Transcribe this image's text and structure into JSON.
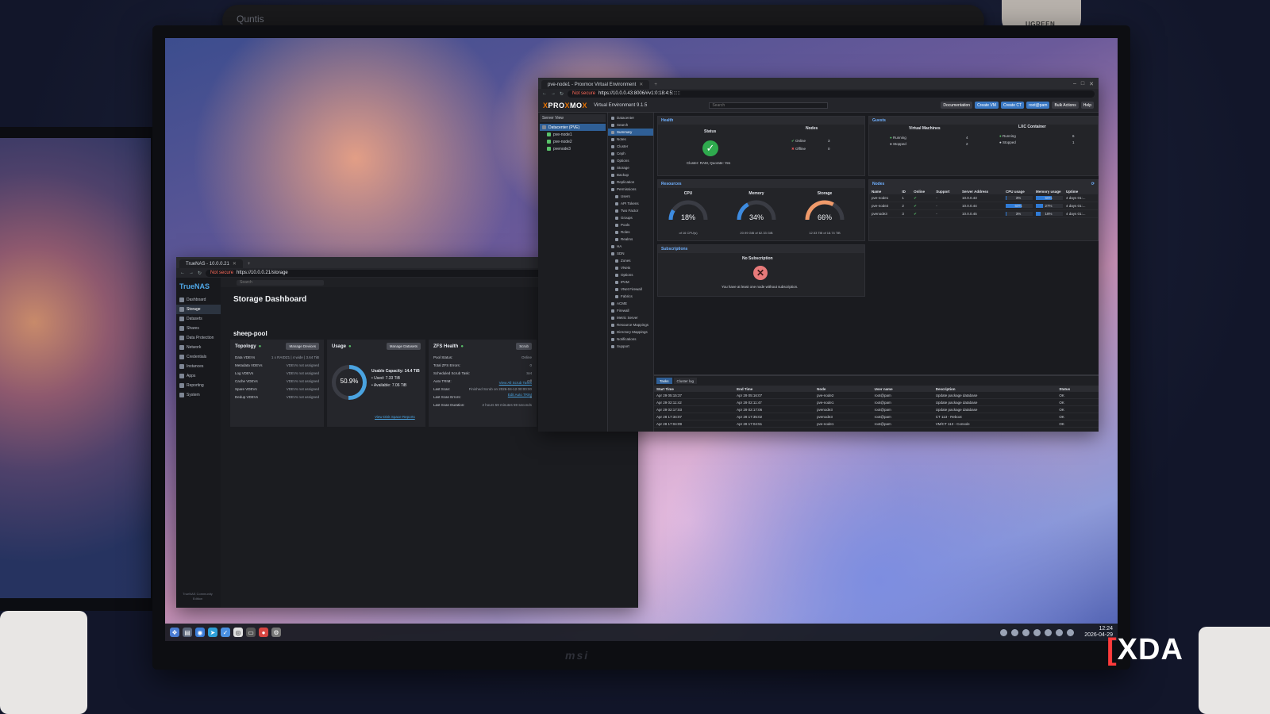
{
  "room": {
    "lightbar_brand": "Quntis",
    "webcam_brand": "UGREEN",
    "monitor_brand": "msi"
  },
  "watermark": {
    "bracket": "[",
    "text": "XDA"
  },
  "taskbar": {
    "clock_time": "12:24",
    "clock_date": "2026-04-29"
  },
  "truenas": {
    "tab_title": "TrueNAS - 10.0.0.21",
    "url_not_secure": "Not secure",
    "url": "https://10.0.0.21/storage",
    "logo": "TrueNAS",
    "search_placeholder": "Search",
    "page_title": "Storage Dashboard",
    "pool_name": "sheep-pool",
    "nav": [
      "Dashboard",
      "Storage",
      "Datasets",
      "Shares",
      "Data Protection",
      "Network",
      "Credentials",
      "Instances",
      "Apps",
      "Reporting",
      "System"
    ],
    "topology": {
      "title": "Topology",
      "button": "Manage Devices",
      "rows": [
        {
          "k": "Data VDEVs",
          "v": "1 x RAIDZ1 | 4 wide | 3.64 TiB"
        },
        {
          "k": "Metadata VDEVs",
          "v": "VDEVs not assigned"
        },
        {
          "k": "Log VDEVs",
          "v": "VDEVs not assigned"
        },
        {
          "k": "Cache VDEVs",
          "v": "VDEVs not assigned"
        },
        {
          "k": "Spare VDEVs",
          "v": "VDEVs not assigned"
        },
        {
          "k": "Dedup VDEVs",
          "v": "VDEVs not assigned"
        }
      ]
    },
    "usage": {
      "title": "Usage",
      "button": "Manage Datasets",
      "percent": 50.9,
      "percent_label": "50.9%",
      "capacity": "Usable Capacity: 14.4 TiB",
      "used": "Used: 7.33 TiB",
      "available": "Available: 7.06 TiB",
      "link": "View Disk Space Reports"
    },
    "zfs": {
      "title": "ZFS Health",
      "button": "Scrub",
      "rows": [
        {
          "k": "Pool Status:",
          "v": "Online"
        },
        {
          "k": "Total ZFS Errors:",
          "v": "0"
        },
        {
          "k": "Scheduled Scrub Task:",
          "v": "Set"
        },
        {
          "k": "Auto TRIM:",
          "v": "Off"
        },
        {
          "k": "Last Scan:",
          "v": "Finished Scrub on 2026-04-12 00:00:00"
        },
        {
          "k": "Last Scan Errors:",
          "v": "0"
        },
        {
          "k": "Last Scan Duration:",
          "v": "2 hours 59 minutes 59 seconds"
        }
      ],
      "link1": "View All Scrub Tasks",
      "link2": "Edit Auto TRIM"
    },
    "footer": "TrueNAS Community Edition"
  },
  "proxmox": {
    "tab_title": "pve-node1 - Proxmox Virtual Environment",
    "url_not_secure": "Not secure",
    "url": "https://10.0.0.43:8006/#v1:0:18:4:5::::::",
    "logo_pro": "PRO",
    "logo_x": "X",
    "logo_mo": "MO",
    "version": "Virtual Environment 9.1.5",
    "search_placeholder": "Search",
    "header_buttons": [
      "Documentation",
      "Create VM",
      "Create CT",
      "root@pam"
    ],
    "bulk_actions": "Bulk Actions",
    "help": "Help",
    "tree": {
      "view": "Server View",
      "items": [
        "Datacenter (PVE)",
        "pve-node1",
        "pve-node2",
        "pvenode3"
      ]
    },
    "menu": [
      "Datacenter",
      "Search",
      "Summary",
      "Notes",
      "Cluster",
      "Ceph",
      "Options",
      "Storage",
      "Backup",
      "Replication",
      "Permissions",
      "Users",
      "API Tokens",
      "Two Factor",
      "Groups",
      "Pools",
      "Roles",
      "Realms",
      "HA",
      "SDN",
      "Zones",
      "VNets",
      "Options",
      "IPAM",
      "VNet Firewall",
      "Fabrics",
      "ACME",
      "Firewall",
      "Metric Server",
      "Resource Mappings",
      "Directory Mappings",
      "Notifications",
      "Support"
    ],
    "health": {
      "title": "Health",
      "status_label": "Status",
      "nodes_label": "Nodes",
      "cluster_text": "Cluster: RAM, Quorate: Yes",
      "online_label": "Online",
      "online_count": 3,
      "offline_label": "Offline",
      "offline_count": 0
    },
    "guests": {
      "title": "Guests",
      "vm_label": "Virtual Machines",
      "ct_label": "LXC Container",
      "vm_running_label": "Running",
      "vm_running": 4,
      "vm_stopped_label": "Stopped",
      "vm_stopped": 2,
      "ct_running_label": "Running",
      "ct_running": 6,
      "ct_stopped_label": "Stopped",
      "ct_stopped": 1
    },
    "resources": {
      "title": "Resources",
      "cpu": {
        "label": "CPU",
        "value": 18,
        "text": "18%",
        "sub": "of 16 CPU(s)"
      },
      "memory": {
        "label": "Memory",
        "value": 34,
        "text": "34%",
        "sub": "20.99 GiB of 62.33 GiB"
      },
      "storage": {
        "label": "Storage",
        "value": 66,
        "text": "66%",
        "sub": "12.53 TiB of 18.74 TiB"
      }
    },
    "subscriptions": {
      "title": "Subscriptions",
      "heading": "No Subscription",
      "text": "You have at least one node without subscription."
    },
    "nodes": {
      "title": "Nodes",
      "columns": [
        "Name",
        "ID",
        "Online",
        "Support",
        "Server Address",
        "CPU usage",
        "Memory usage",
        "Uptime"
      ],
      "rows": [
        {
          "name": "pve-node1",
          "id": "1",
          "online": "✔",
          "support": "-",
          "addr": "10.0.0.43",
          "cpu": 3,
          "cpu_text": "3%",
          "mem": 60,
          "mem_text": "60%",
          "uptime": "4 days 01:..."
        },
        {
          "name": "pve-node2",
          "id": "2",
          "online": "✔",
          "support": "-",
          "addr": "10.0.0.44",
          "cpu": 60,
          "cpu_text": "60%",
          "mem": 27,
          "mem_text": "27%",
          "uptime": "4 days 01:..."
        },
        {
          "name": "pvenode3",
          "id": "3",
          "online": "✔",
          "support": "-",
          "addr": "10.0.0.45",
          "cpu": 3,
          "cpu_text": "3%",
          "mem": 18,
          "mem_text": "18%",
          "uptime": "4 days 01:..."
        }
      ]
    },
    "tasklog": {
      "tabs": [
        "Tasks",
        "Cluster log"
      ],
      "columns": [
        "Start Time",
        "End Time",
        "Node",
        "User name",
        "Description",
        "Status"
      ],
      "rows": [
        {
          "start": "Apr 29 05:15:37",
          "end": "Apr 29 05:16:07",
          "node": "pve-node2",
          "user": "root@pam",
          "desc": "Update package database",
          "status": "OK"
        },
        {
          "start": "Apr 29 02:11:42",
          "end": "Apr 29 02:11:47",
          "node": "pve-node1",
          "user": "root@pam",
          "desc": "Update package database",
          "status": "OK"
        },
        {
          "start": "Apr 29 02:17:03",
          "end": "Apr 29 02:17:06",
          "node": "pvenode3",
          "user": "root@pam",
          "desc": "Update package database",
          "status": "OK"
        },
        {
          "start": "Apr 28 17:34:07",
          "end": "Apr 28 17:35:02",
          "node": "pvenode3",
          "user": "root@pam",
          "desc": "CT 113 - Reboot",
          "status": "OK"
        },
        {
          "start": "Apr 28 17:04:09",
          "end": "Apr 28 17:04:51",
          "node": "pve-node1",
          "user": "root@pam",
          "desc": "VM/CT 113 - Console",
          "status": "OK"
        }
      ]
    }
  }
}
